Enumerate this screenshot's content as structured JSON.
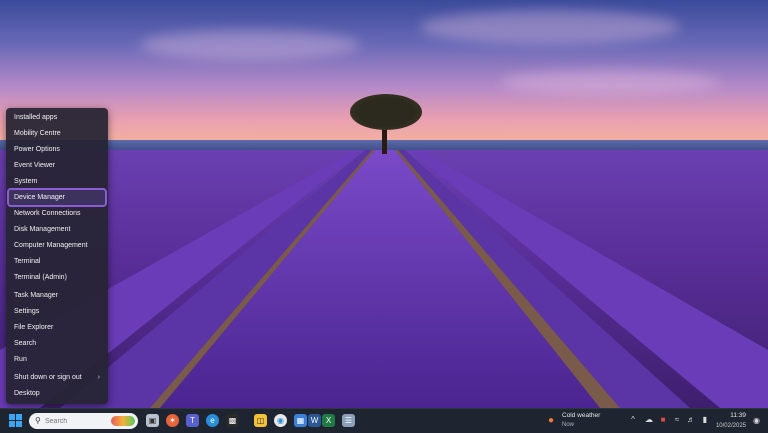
{
  "menu": {
    "items": [
      {
        "label": "Installed apps"
      },
      {
        "label": "Mobility Centre"
      },
      {
        "label": "Power Options"
      },
      {
        "label": "Event Viewer"
      },
      {
        "label": "System"
      },
      {
        "label": "Device Manager",
        "selected": true
      },
      {
        "label": "Network Connections"
      },
      {
        "label": "Disk Management"
      },
      {
        "label": "Computer Management"
      },
      {
        "label": "Terminal"
      },
      {
        "label": "Terminal (Admin)"
      },
      {
        "label": "Task Manager"
      },
      {
        "label": "Settings"
      },
      {
        "label": "File Explorer"
      },
      {
        "label": "Search"
      },
      {
        "label": "Run"
      },
      {
        "label": "Shut down or sign out",
        "submenu_chevron": "›"
      },
      {
        "label": "Desktop"
      }
    ]
  },
  "taskbar": {
    "search": {
      "placeholder": "Search",
      "icon": "search-icon"
    },
    "weather": {
      "line1": "Cold weather",
      "line2": "Now",
      "icon": "thermometer-icon"
    },
    "clock": {
      "time": "11:39",
      "date": "10/02/2025"
    },
    "accent_color": "#3aa6f2"
  }
}
